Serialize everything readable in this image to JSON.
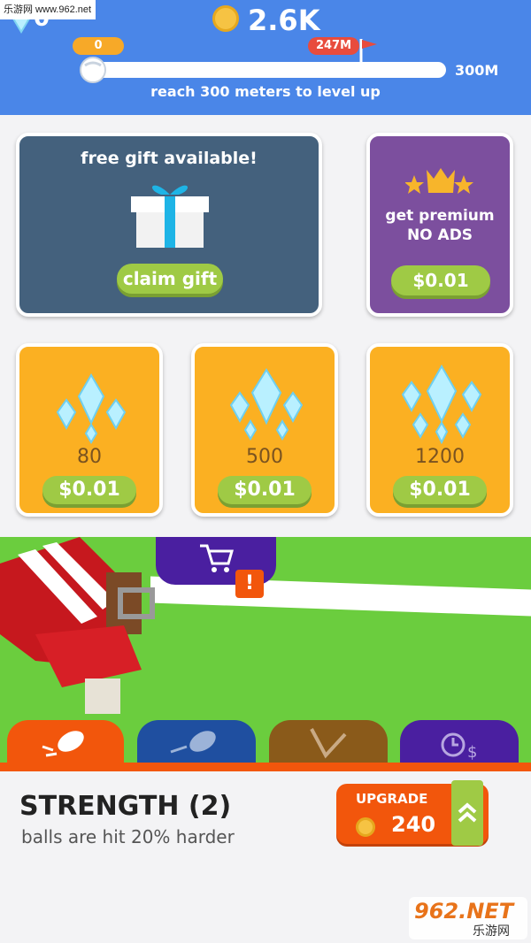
{
  "watermark_top": "乐游网 www.962.net",
  "header": {
    "gems": "0",
    "coins": "2.6K",
    "progress": {
      "start_label": "0",
      "best_label": "247M",
      "goal_label": "300M",
      "fraction": 0.02,
      "best_fraction": 0.82
    },
    "level_text": "reach 300 meters to level up"
  },
  "shop": {
    "gift": {
      "title": "free gift available!",
      "button": "claim gift"
    },
    "premium": {
      "line1": "get premium",
      "line2": "NO ADS",
      "price": "$0.01"
    },
    "gem_packs": [
      {
        "amount": "80",
        "price": "$0.01"
      },
      {
        "amount": "500",
        "price": "$0.01"
      },
      {
        "amount": "1200",
        "price": "$0.01"
      }
    ]
  },
  "alert_badge": "!",
  "tabs": [
    {
      "icon": "football-hit-icon",
      "color": "#f2560c"
    },
    {
      "icon": "football-throw-icon",
      "color": "#1f4fa0"
    },
    {
      "icon": "bounce-icon",
      "color": "#8a5a1a"
    },
    {
      "icon": "offline-earnings-icon",
      "color": "#4a1fa0"
    }
  ],
  "upgrade_panel": {
    "title": "STRENGTH (2)",
    "description": "balls are hit 20% harder",
    "button_label": "UPGRADE",
    "cost": "240"
  },
  "watermark_bottom": {
    "brand": "962.NET",
    "sub": "乐游网"
  }
}
